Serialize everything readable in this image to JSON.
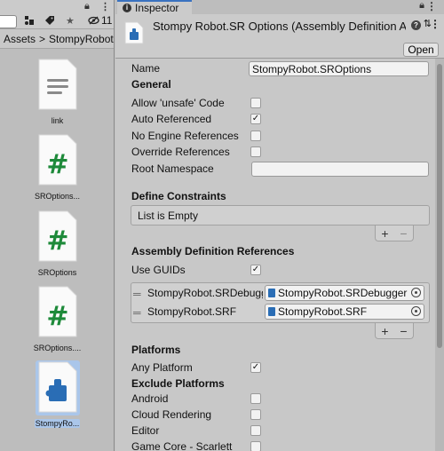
{
  "project": {
    "hidden_count": "11",
    "breadcrumb": [
      "Assets",
      "StompyRobot"
    ],
    "assets": [
      {
        "label": "link",
        "icon": "text-file-icon"
      },
      {
        "label": "SROptions...",
        "icon": "csharp-script-icon"
      },
      {
        "label": "SROptions",
        "icon": "csharp-script-icon"
      },
      {
        "label": "SROptions....",
        "icon": "csharp-script-icon"
      },
      {
        "label": "StompyRo...",
        "icon": "assembly-definition-icon",
        "selected": true
      }
    ]
  },
  "inspector": {
    "tab_label": "Inspector",
    "title": "Stompy Robot.SR Options (Assembly Definition A",
    "open_label": "Open",
    "name_label": "Name",
    "name_value": "StompyRobot.SROptions",
    "general": {
      "heading": "General",
      "fields": [
        {
          "label": "Allow 'unsafe' Code",
          "checked": false
        },
        {
          "label": "Auto Referenced",
          "checked": true
        },
        {
          "label": "No Engine References",
          "checked": false
        },
        {
          "label": "Override References",
          "checked": false
        }
      ],
      "root_namespace_label": "Root Namespace",
      "root_namespace_value": ""
    },
    "define_constraints": {
      "heading": "Define Constraints",
      "empty_text": "List is Empty"
    },
    "assembly_refs": {
      "heading": "Assembly Definition References",
      "use_guids_label": "Use GUIDs",
      "use_guids_checked": true,
      "items": [
        {
          "name": "StompyRobot.SRDebugg",
          "value": "StompyRobot.SRDebugger"
        },
        {
          "name": "StompyRobot.SRF",
          "value": "StompyRobot.SRF"
        }
      ]
    },
    "platforms": {
      "heading": "Platforms",
      "any_platform_label": "Any Platform",
      "any_platform_checked": true,
      "exclude_heading": "Exclude Platforms",
      "items": [
        {
          "label": "Android",
          "checked": false
        },
        {
          "label": "Cloud Rendering",
          "checked": false
        },
        {
          "label": "Editor",
          "checked": false
        },
        {
          "label": "Game Core - Scarlett",
          "checked": false
        }
      ]
    },
    "list_add": "+",
    "list_remove": "−"
  },
  "colors": {
    "accent": "#3a72c0",
    "script_green": "#1e8a3a",
    "asmdef_blue": "#2a6db5"
  }
}
